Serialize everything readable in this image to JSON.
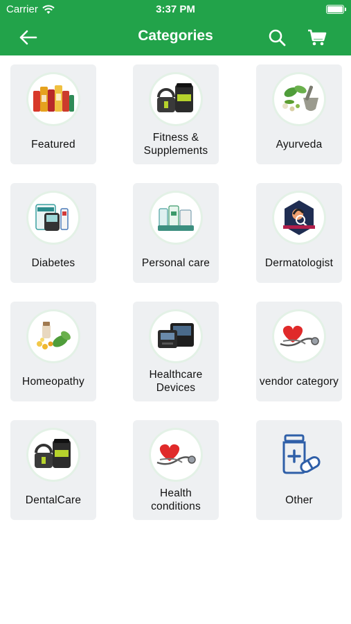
{
  "status_bar": {
    "carrier": "Carrier",
    "time": "3:37 PM"
  },
  "header": {
    "title": "Categories"
  },
  "colors": {
    "primary": "#22a34a",
    "tile_bg": "#eef0f2",
    "icon_blue": "#2f5fa8"
  },
  "categories": [
    {
      "label": "Featured",
      "icon": "featured-products-icon"
    },
    {
      "label": "Fitness & Supplements",
      "icon": "fitness-supplements-icon"
    },
    {
      "label": "Ayurveda",
      "icon": "ayurveda-icon"
    },
    {
      "label": "Diabetes",
      "icon": "diabetes-icon"
    },
    {
      "label": "Personal care",
      "icon": "personal-care-icon"
    },
    {
      "label": "Dermatologist",
      "icon": "dermatologist-icon"
    },
    {
      "label": "Homeopathy",
      "icon": "homeopathy-icon"
    },
    {
      "label": "Healthcare Devices",
      "icon": "healthcare-devices-icon"
    },
    {
      "label": "vendor category",
      "icon": "stethoscope-heart-icon"
    },
    {
      "label": "DentalCare",
      "icon": "dentalcare-icon"
    },
    {
      "label": "Health conditions",
      "icon": "stethoscope-heart-icon"
    },
    {
      "label": "Other",
      "icon": "medicine-bottle-icon"
    }
  ]
}
